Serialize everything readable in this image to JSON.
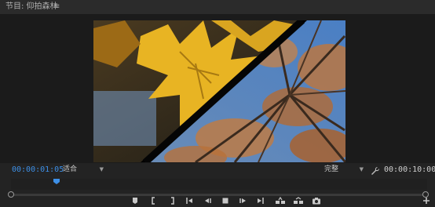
{
  "panel": {
    "title": "节目: 仰拍森林",
    "menu_icon": "hamburger-menu-icon"
  },
  "playback": {
    "current_timecode": "00:00:01:05",
    "duration_timecode": "00:00:10:00",
    "fit_option": "适合",
    "resolution_option": "完整",
    "playhead_position_fraction": 0.11
  },
  "transport_buttons": [
    "add-marker-icon",
    "mark-in-icon",
    "mark-out-icon",
    "go-to-in-icon",
    "step-back-icon",
    "stop-icon",
    "step-forward-icon",
    "go-to-out-icon",
    "lift-icon",
    "extract-icon",
    "export-frame-icon"
  ],
  "colors": {
    "accent_timecode": "#3d8fe6",
    "panel_bg": "#232323"
  }
}
